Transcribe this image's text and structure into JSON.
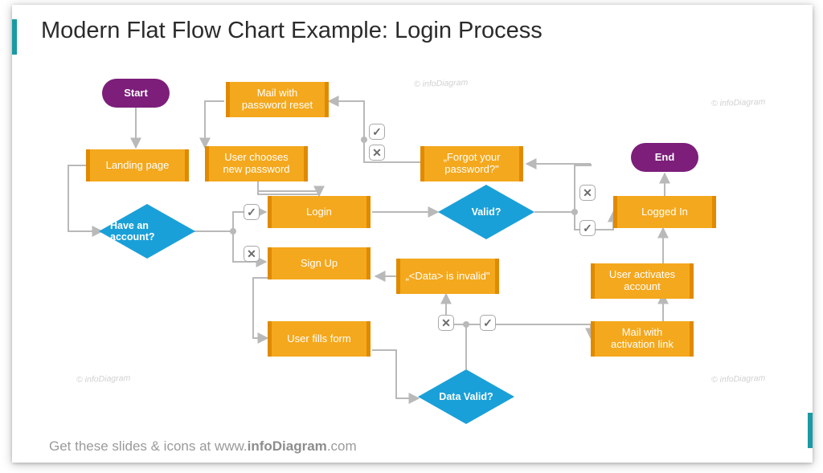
{
  "title": "Modern Flat Flow Chart Example: Login Process",
  "footer": {
    "prefix": "Get these slides & icons at ",
    "brand_prefix": "www.",
    "brand_bold": "infoDiagram",
    "brand_suffix": ".com"
  },
  "watermark": "© infoDiagram",
  "colors": {
    "title": "#2b2b2b",
    "terminator": "#7c1e7a",
    "process": "#f4a81d",
    "process_edge": "#e08a00",
    "decision": "#1aa0d8",
    "connector": "#b9b9b9",
    "accent": "#1a9aa3",
    "footer": "#9a9a9a"
  },
  "nodes": {
    "start": {
      "label": "Start",
      "type": "terminator"
    },
    "landing": {
      "label": "Landing page",
      "type": "process"
    },
    "have_acct": {
      "label": "Have an account?",
      "type": "decision"
    },
    "login": {
      "label": "Login",
      "type": "process"
    },
    "signup": {
      "label": "Sign Up",
      "type": "process"
    },
    "user_fills": {
      "label": "User fills form",
      "type": "process"
    },
    "data_valid": {
      "label": "Data Valid?",
      "type": "decision"
    },
    "data_invalid": {
      "label": "„<Data> is invalid\"",
      "type": "process"
    },
    "mail_link": {
      "label": "Mail with activation link",
      "type": "process"
    },
    "user_act": {
      "label": "User activates account",
      "type": "process"
    },
    "valid": {
      "label": "Valid?",
      "type": "decision"
    },
    "forgot": {
      "label": "„Forgot your password?\"",
      "type": "process"
    },
    "mail_reset": {
      "label": "Mail with password reset",
      "type": "process"
    },
    "new_pw": {
      "label": "User chooses new password",
      "type": "process"
    },
    "logged_in": {
      "label": "Logged In",
      "type": "process"
    },
    "end": {
      "label": "End",
      "type": "terminator"
    }
  },
  "branch_markers": {
    "yes": "✓",
    "no": "✕"
  },
  "edges": [
    {
      "from": "start",
      "to": "landing"
    },
    {
      "from": "landing",
      "to": "have_acct"
    },
    {
      "from": "have_acct",
      "to": "login",
      "cond": "yes"
    },
    {
      "from": "have_acct",
      "to": "signup",
      "cond": "no"
    },
    {
      "from": "login",
      "to": "valid"
    },
    {
      "from": "signup",
      "to": "user_fills"
    },
    {
      "from": "user_fills",
      "to": "data_valid"
    },
    {
      "from": "data_valid",
      "to": "data_invalid",
      "cond": "no"
    },
    {
      "from": "data_invalid",
      "to": "signup"
    },
    {
      "from": "data_valid",
      "to": "mail_link",
      "cond": "yes"
    },
    {
      "from": "mail_link",
      "to": "user_act"
    },
    {
      "from": "user_act",
      "to": "logged_in"
    },
    {
      "from": "valid",
      "to": "logged_in",
      "cond": "yes"
    },
    {
      "from": "valid",
      "to": "forgot",
      "cond": "no"
    },
    {
      "from": "forgot",
      "to": "mail_reset"
    },
    {
      "from": "mail_reset",
      "to": "new_pw"
    },
    {
      "from": "new_pw",
      "to": "login"
    },
    {
      "from": "logged_in",
      "to": "end"
    }
  ]
}
